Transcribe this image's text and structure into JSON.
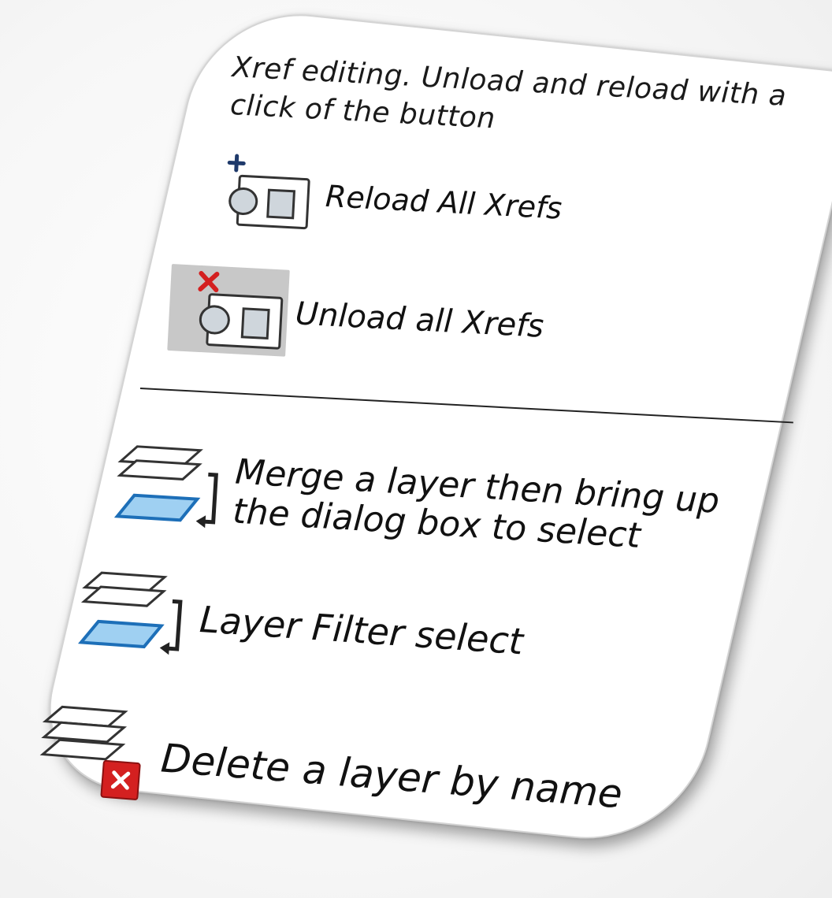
{
  "intro": {
    "text": "Xref editing. Unload and reload with a click of the button"
  },
  "xref_tools": [
    {
      "label": "Reload All Xrefs",
      "icon": "reload-xrefs-icon"
    },
    {
      "label": "Unload all Xrefs",
      "icon": "unload-xrefs-icon"
    }
  ],
  "layer_tools": [
    {
      "label": "Merge a layer then bring up the dialog box to select",
      "icon": "layer-merge-icon"
    },
    {
      "label": "Layer Filter select",
      "icon": "layer-filter-icon"
    },
    {
      "label": "Delete a layer by name",
      "icon": "layer-delete-icon"
    }
  ],
  "colors": {
    "plus_accent": "#1f3a6b",
    "delete_red": "#d42020",
    "layer_blue": "#4aa3df",
    "highlight_bg": "#c8c8c8"
  }
}
